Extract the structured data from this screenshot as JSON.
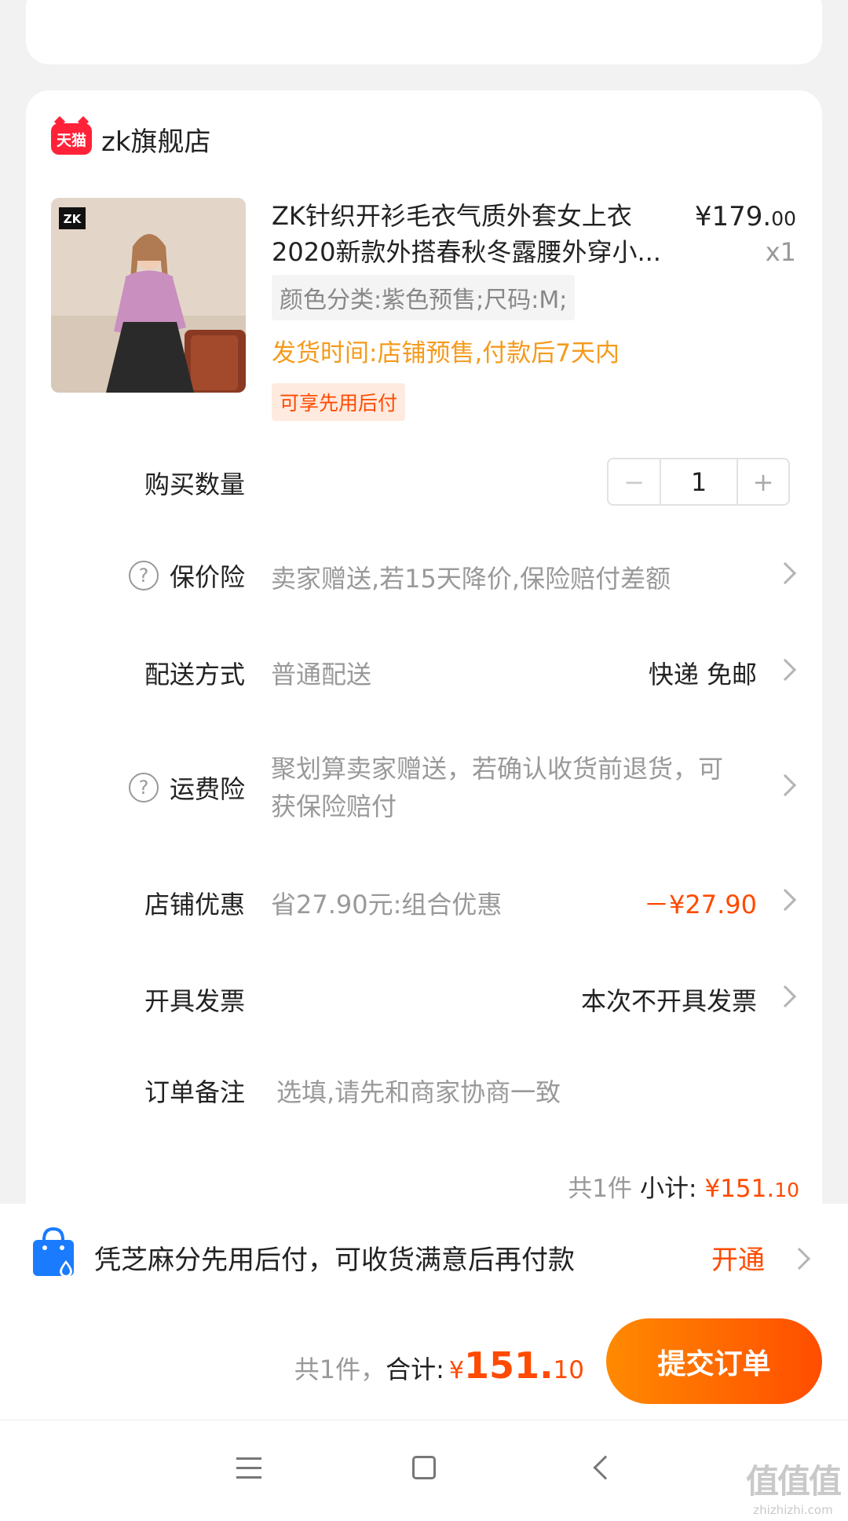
{
  "shop": {
    "badge": "天猫",
    "name": "zk旗舰店"
  },
  "product": {
    "thumb_logo": "ZK",
    "title_line1": "ZK针织开衫毛衣气质外套女上衣",
    "title_line2": "2020新款外搭春秋冬露腰外穿小...",
    "price_main": "¥179.",
    "price_dec": "00",
    "qty": "x1",
    "spec": "颜色分类:紫色预售;尺码:M;",
    "ship_time": "发货时间:店铺预售,付款后7天内",
    "pay_later": "可享先用后付"
  },
  "rows": {
    "quantity": {
      "label": "购买数量",
      "minus": "−",
      "value": "1",
      "plus": "+"
    },
    "price_protect": {
      "icon": "?",
      "label": "保价险",
      "desc": "卖家赠送,若15天降价,保险赔付差额"
    },
    "delivery": {
      "label": "配送方式",
      "desc": "普通配送",
      "value": "快递 免邮"
    },
    "freight_ins": {
      "icon": "?",
      "label": "运费险",
      "desc_line1": "聚划算卖家赠送，若确认收货前退货，可",
      "desc_line2": "获保险赔付"
    },
    "discount": {
      "label": "店铺优惠",
      "desc": "省27.90元:组合优惠",
      "value": "－¥27.90"
    },
    "invoice": {
      "label": "开具发票",
      "value": "本次不开具发票"
    },
    "note": {
      "label": "订单备注",
      "placeholder": "选填,请先和商家协商一致"
    }
  },
  "subtotal": {
    "count": "共1件",
    "label": "小计:",
    "value_main": "¥151.",
    "value_dec": "10"
  },
  "promo": {
    "text": "凭芝麻分先用后付，可收货满意后再付款",
    "action": "开通"
  },
  "bottom": {
    "count": "共1件，",
    "label": "合计:",
    "currency": "¥",
    "int": "151.",
    "dec": "10",
    "submit": "提交订单"
  },
  "watermark": {
    "line1": "值值值",
    "line2": "zhizhizhi.com"
  },
  "colors": {
    "accent": "#ff4a00",
    "ship_time": "#f59a1c",
    "tmall": "#ff2238"
  }
}
